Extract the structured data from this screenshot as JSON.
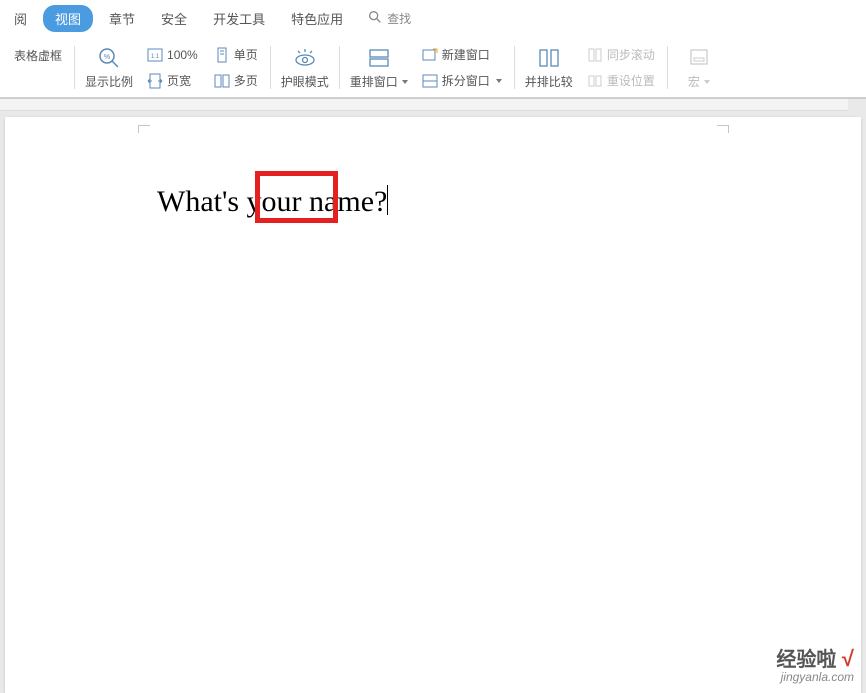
{
  "menu": {
    "items": [
      "阅",
      "视图",
      "章节",
      "安全",
      "开发工具",
      "特色应用"
    ],
    "active_index": 1,
    "search_label": "查找"
  },
  "ribbon": {
    "table_frame": "表格虚框",
    "zoom_ratio": "显示比例",
    "zoom_100": "100%",
    "page_width": "页宽",
    "single_page": "单页",
    "multi_page": "多页",
    "eye_care": "护眼模式",
    "rearrange": "重排窗口",
    "new_window": "新建窗口",
    "split_window": "拆分窗口",
    "side_by_side": "并排比较",
    "sync_scroll": "同步滚动",
    "reset_position": "重设位置",
    "macro": "宏"
  },
  "document": {
    "text_before": "What's ",
    "text_highlight": "your",
    "text_after": " name?"
  },
  "watermark": {
    "brand": "经验啦",
    "check": "√",
    "url": "jingyanla.com"
  }
}
